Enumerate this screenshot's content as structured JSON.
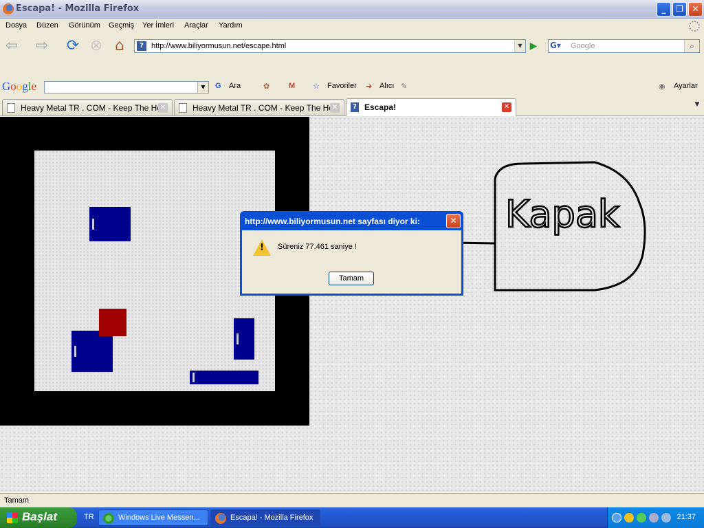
{
  "window": {
    "title": "Escapa! - Mozilla Firefox"
  },
  "menu": [
    "Dosya",
    "Düzen",
    "Görünüm",
    "Geçmiş",
    "Yer İmleri",
    "Araçlar",
    "Yardım"
  ],
  "nav": {
    "url": "http://www.biliyormusun.net/escape.html",
    "search_placeholder": "Google"
  },
  "google_toolbar": {
    "logo": "Google",
    "search_label": "Ara",
    "favorites_label": "Favoriler",
    "alici_label": "Alıcı",
    "settings_label": "Ayarlar"
  },
  "tabs": [
    {
      "label": "Heavy Metal TR . COM - Keep The He..."
    },
    {
      "label": "Heavy Metal TR . COM - Keep The He..."
    },
    {
      "label": "Escapa!"
    }
  ],
  "dialog": {
    "title": "http://www.biliyormusun.net sayfası diyor ki:",
    "message": "Süreniz 77.461 saniye !",
    "ok_label": "Tamam"
  },
  "annotation": {
    "handwritten_text": "Kapak"
  },
  "status": {
    "text": "Tamam"
  },
  "taskbar": {
    "start_label": "Başlat",
    "language": "TR",
    "tasks": [
      {
        "label": "Windows Live Messen..."
      },
      {
        "label": "Escapa! - Mozilla Firefox"
      }
    ],
    "clock": "21:37"
  },
  "colors": {
    "game_border": "#000000",
    "enemy_block": "#00008f",
    "player_block": "#a00000",
    "xp_taskbar": "#245edb",
    "xp_start": "#2f8a2f"
  }
}
